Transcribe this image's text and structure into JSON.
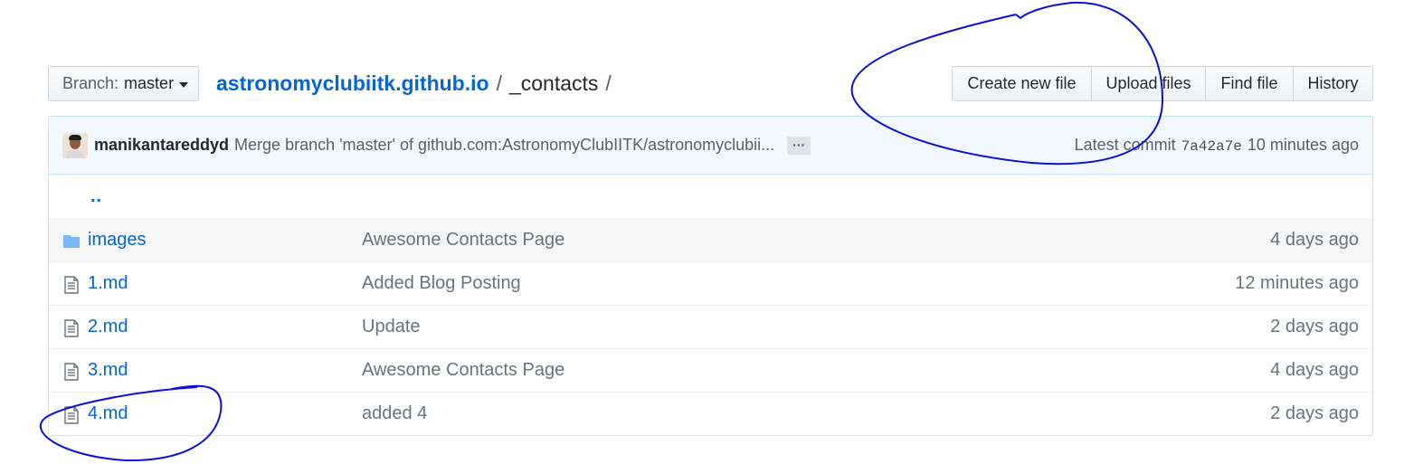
{
  "branch": {
    "label": "Branch:",
    "value": "master"
  },
  "breadcrumb": {
    "repo": "astronomyclubiitk.github.io",
    "separator": "/",
    "dir": "_contacts",
    "trailing": "/"
  },
  "actions": [
    "Create new file",
    "Upload files",
    "Find file",
    "History"
  ],
  "commit": {
    "author": "manikantareddyd",
    "message": "Merge branch 'master' of github.com:AstronomyClubIITK/astronomyclubii...",
    "ellipsis": "…",
    "latest_label": "Latest commit",
    "sha": "7a42a7e",
    "age": "10 minutes ago"
  },
  "parent_link": "..",
  "files": [
    {
      "name": "images",
      "type": "folder",
      "message": "Awesome Contacts Page",
      "age": "4 days ago"
    },
    {
      "name": "1.md",
      "type": "file",
      "message": "Added Blog Posting",
      "age": "12 minutes ago"
    },
    {
      "name": "2.md",
      "type": "file",
      "message": "Update",
      "age": "2 days ago"
    },
    {
      "name": "3.md",
      "type": "file",
      "message": "Awesome Contacts Page",
      "age": "4 days ago"
    },
    {
      "name": "4.md",
      "type": "file",
      "message": "added 4",
      "age": "2 days ago"
    }
  ],
  "colors": {
    "link": "#0366d6",
    "annotation": "#0a10d8",
    "commit_bar_bg": "#f1f8ff",
    "folder": "#79b8ff"
  },
  "icons": {
    "folder": "folder-icon",
    "file": "file-text-icon",
    "caret": "caret-down-icon"
  }
}
